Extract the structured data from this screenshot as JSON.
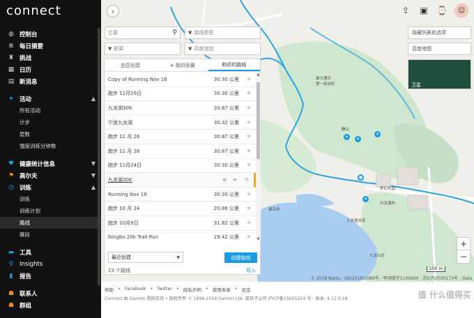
{
  "brand": "connect",
  "sidebar": {
    "items": [
      {
        "label": "控制台",
        "icon": "dashboard-icon",
        "kind": "main"
      },
      {
        "label": "每日摘要",
        "icon": "layers-icon",
        "kind": "main"
      },
      {
        "label": "挑战",
        "icon": "trophy-icon",
        "kind": "main"
      },
      {
        "label": "日历",
        "icon": "calendar-icon",
        "kind": "main"
      },
      {
        "label": "新消息",
        "icon": "news-icon",
        "kind": "main"
      }
    ],
    "activity": {
      "label": "活动",
      "icon": "runner-icon",
      "subs": [
        "所有活动",
        "计步",
        "层数",
        "强度训练分钟数"
      ]
    },
    "health": [
      {
        "label": "健康统计信息",
        "icon": "heart-icon"
      },
      {
        "label": "高尔夫",
        "icon": "golf-flag-icon"
      }
    ],
    "training": {
      "label": "训练",
      "icon": "stopwatch-icon",
      "subs": [
        "训练",
        "训练计划",
        "路线",
        "赛段"
      ],
      "active_sub": "路线"
    },
    "tools": [
      {
        "label": "工具",
        "icon": "toolbox-icon"
      },
      {
        "label": "Insights",
        "icon": "bulb-icon"
      },
      {
        "label": "报告",
        "icon": "report-icon"
      }
    ],
    "social": [
      {
        "label": "联系人",
        "icon": "contacts-icon"
      },
      {
        "label": "群组",
        "icon": "groups-icon"
      }
    ]
  },
  "filters": {
    "location_placeholder": "位置",
    "route_type": "路线类型",
    "distance": "距离",
    "elevation_gain": "高度增加"
  },
  "tabs": [
    "由您创建",
    "我的收藏",
    "附近的路线"
  ],
  "routes": [
    {
      "name": "Copy of Running Nov 16",
      "distance": "30.30 公里"
    },
    {
      "name": "跑步 11月29日",
      "distance": "30.30 公里"
    },
    {
      "name": "九龙湖30K",
      "distance": "30.87 公里"
    },
    {
      "name": "宁波九龙湖",
      "distance": "30.32 公里"
    },
    {
      "name": "跑步 11 月 26",
      "distance": "30.87 公里"
    },
    {
      "name": "跑步 11 月 26",
      "distance": "30.87 公里"
    },
    {
      "name": "跑步 11月24日",
      "distance": "30.30 公里"
    },
    {
      "name": "九龙湖30K",
      "distance": "",
      "highlight": true
    },
    {
      "name": "Running Nov 16",
      "distance": "30.30 公里"
    },
    {
      "name": "跑步 10 月 24",
      "distance": "20.86 公里"
    },
    {
      "name": "跑步 10月9日",
      "distance": "31.82 公里"
    },
    {
      "name": "Ningbo 20k Trail Run",
      "distance": "19.42 公里"
    }
  ],
  "sort_value": "最近创建",
  "create_route": "创建路线",
  "route_count": "23 个路线",
  "import_label": "导入",
  "map_overlays": {
    "hide_list": "隐藏列表和选项",
    "baidu_map": "百度地图",
    "satellite": "卫星",
    "scale": "100 m",
    "copyright": "© 2018 Baidu - GS(2016)2089号 - 甲测资字1100930 - 京ICP证030173号 - Data ©"
  },
  "map_labels": [
    {
      "text": "聚力通天",
      "id": "label-1"
    },
    {
      "text": "第一级台阶",
      "id": "label-2"
    },
    {
      "text": "醮山",
      "id": "label-3"
    },
    {
      "text": "梦幻乐园",
      "id": "label-4"
    },
    {
      "text": "白龙瀑布",
      "id": "label-5"
    },
    {
      "text": "九龙湖水库",
      "id": "label-6"
    },
    {
      "text": "九龙山庄",
      "id": "label-7"
    },
    {
      "text": "暮名桥",
      "id": "label-8"
    }
  ],
  "footer": {
    "links": [
      "帮助",
      "Facebook",
      "Twitter",
      "隐私声明",
      "使用条款",
      "状态"
    ],
    "line": "Connect 由 Garmin 提供支持 • 版权所有 © 1996-2018 Garmin Ltd. 或其子公司 沪ICP备15055224 号 - 版本: 4.12.0.18",
    "watermark": "值 什么值得买"
  },
  "colors": {
    "accent": "#1a9be6",
    "sidebar_bg": "#111111",
    "highlight": "#f5a623"
  }
}
